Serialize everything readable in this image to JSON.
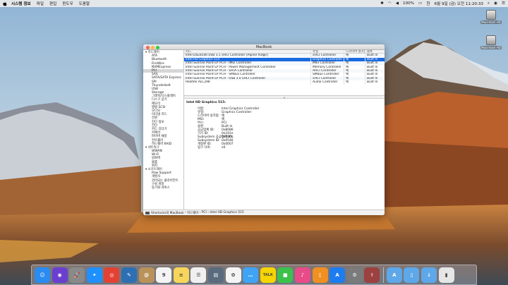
{
  "menubar": {
    "app_name": "시스템 정보",
    "menus": [
      "파일",
      "편집",
      "윈도우",
      "도움말"
    ],
    "battery": "100%",
    "datetime": "6월 9일 (금) 오전 11:20:33"
  },
  "desktop": {
    "disks": [
      "Macintosh HD",
      "Macintosh HD"
    ]
  },
  "window": {
    "title": "MacBook",
    "sidebar": [
      {
        "label": "▾ 하드웨어",
        "group": true
      },
      {
        "label": "ATA"
      },
      {
        "label": "Bluetooth"
      },
      {
        "label": "FireWire"
      },
      {
        "label": "NVMExpress"
      },
      {
        "label": "PCI",
        "selected": true
      },
      {
        "label": "SAS"
      },
      {
        "label": "SATA/SATA Express"
      },
      {
        "label": "SPI"
      },
      {
        "label": "Thunderbolt"
      },
      {
        "label": "USB"
      },
      {
        "label": "Storage"
      },
      {
        "label": "그래픽/디스플레이"
      },
      {
        "label": "디스크 굽기"
      },
      {
        "label": "메모리"
      },
      {
        "label": "병렬 SCSI"
      },
      {
        "label": "오디오"
      },
      {
        "label": "이더넷 카드"
      },
      {
        "label": "전원"
      },
      {
        "label": "진단 정보"
      },
      {
        "label": "전단"
      },
      {
        "label": "카드 리더기"
      },
      {
        "label": "카메라"
      },
      {
        "label": "파이버 채널"
      },
      {
        "label": "컨트롤러"
      },
      {
        "label": "하드웨어 RAID"
      },
      {
        "label": "▾ 네트워크",
        "group": true
      },
      {
        "label": "WWAN"
      },
      {
        "label": "Wi-Fi"
      },
      {
        "label": "방화벽"
      },
      {
        "label": "볼륨"
      },
      {
        "label": "위치"
      },
      {
        "label": "▾ 소프트웨어",
        "group": true
      },
      {
        "label": "Raw Support"
      },
      {
        "label": "개발자"
      },
      {
        "label": "관리되는 클라이언트"
      },
      {
        "label": "구성 파일"
      },
      {
        "label": "동기화 서비스"
      }
    ],
    "table": {
      "headers": [
        "카드",
        "유형",
        "드라이버 설치됨",
        "슬롯"
      ],
      "rows": [
        {
          "card": "Intel DSL6540 USB 3.1 xHCI Controller [Alpine Ridge]",
          "type": "xHCI Controller",
          "driver": "예",
          "slot": "Built In"
        },
        {
          "card": "Intel HD Graphics 515",
          "type": "Graphics Controller",
          "driver": "예",
          "slot": "Built In",
          "selected": true
        },
        {
          "card": "Intel Sunrise Point-LP PCH - IMEI Controller",
          "type": "IMEI Controller",
          "driver": "예",
          "slot": "Built In"
        },
        {
          "card": "Intel Sunrise Point-LP PCH - Power Management Controller",
          "type": "Memory Controller",
          "driver": "예",
          "slot": "Built In"
        },
        {
          "card": "Intel Sunrise Point-LP PCH - SATA Controller",
          "type": "AHCI Controller",
          "driver": "예",
          "slot": "Built In"
        },
        {
          "card": "Intel Sunrise Point-LP PCH - SMBus Controller",
          "type": "SMBus Controller",
          "driver": "예",
          "slot": "Built In"
        },
        {
          "card": "Intel Sunrise Point-LP PCH - USB 3.0 xHCI Controller",
          "type": "xHCI Controller",
          "driver": "예",
          "slot": "Built In"
        },
        {
          "card": "Realtek ALC298",
          "type": "Audio Controller",
          "driver": "예",
          "slot": "Built In"
        }
      ]
    },
    "detail": {
      "title": "Intel HD Graphics 515:",
      "rows": [
        {
          "key": "이름:",
          "value": "Intel Graphics Controller"
        },
        {
          "key": "유형:",
          "value": "Graphics Controller"
        },
        {
          "key": "드라이버 설치됨:",
          "value": "예"
        },
        {
          "key": "MSI:",
          "value": "예"
        },
        {
          "key": "버스:",
          "value": "PCI"
        },
        {
          "key": "슬롯:",
          "value": "Built In"
        },
        {
          "key": "공급업체 ID:",
          "value": "0x8086"
        },
        {
          "key": "기기 ID:",
          "value": "0x191e"
        },
        {
          "key": "Subsystem 공급업체 ID:",
          "value": "0x106b"
        },
        {
          "key": "Subsystem ID:",
          "value": "0x0546"
        },
        {
          "key": "개정판 ID:",
          "value": "0x0007"
        },
        {
          "key": "링크 너비:",
          "value": "x0"
        }
      ]
    },
    "pathbar": [
      "Sherlocks의 MacBook",
      "하드웨어",
      "PCI",
      "Intel HD Graphics 515"
    ]
  },
  "dock": {
    "items": [
      {
        "name": "finder-icon",
        "color": "#2a8cf0",
        "glyph": "☺"
      },
      {
        "name": "siri-icon",
        "color": "#6a3fd0",
        "glyph": "◉"
      },
      {
        "name": "launchpad-icon",
        "color": "#8a8a8a",
        "glyph": "🚀"
      },
      {
        "name": "safari-icon",
        "color": "#1e90ff",
        "glyph": "✦"
      },
      {
        "name": "chrome-icon",
        "color": "#e34133",
        "glyph": "◎"
      },
      {
        "name": "photo-app-icon",
        "color": "#2d6fb3",
        "glyph": "✎"
      },
      {
        "name": "contacts-icon",
        "color": "#b9925a",
        "glyph": "@"
      },
      {
        "name": "calendar-icon",
        "color": "#f4f4f4",
        "glyph": "9"
      },
      {
        "name": "notes-icon",
        "color": "#f7d55a",
        "glyph": "≡"
      },
      {
        "name": "reminders-icon",
        "color": "#f0f0f0",
        "glyph": "☰"
      },
      {
        "name": "keynote-icon",
        "color": "#5a6b7e",
        "glyph": "▤"
      },
      {
        "name": "photos-icon",
        "color": "#f4f4f4",
        "glyph": "✿"
      },
      {
        "name": "messages-icon",
        "color": "#3fa4f5",
        "glyph": "…"
      },
      {
        "name": "kakaotalk-icon",
        "color": "#f6d500",
        "glyph": "TALK"
      },
      {
        "name": "facetime-icon",
        "color": "#3cc24b",
        "glyph": "■"
      },
      {
        "name": "itunes-icon",
        "color": "#e84b8a",
        "glyph": "♪"
      },
      {
        "name": "ibooks-icon",
        "color": "#f08f22",
        "glyph": "▯"
      },
      {
        "name": "app-store-icon",
        "color": "#1d7cf0",
        "glyph": "A"
      },
      {
        "name": "system-preferences-icon",
        "color": "#7b7b7b",
        "glyph": "⚙"
      },
      {
        "name": "system-info-icon",
        "color": "#9c4040",
        "glyph": "⚕"
      }
    ],
    "folders": [
      {
        "name": "applications-folder-icon",
        "color": "#5ea7e8",
        "glyph": "A"
      },
      {
        "name": "documents-folder-icon",
        "color": "#5ea7e8",
        "glyph": "▯"
      },
      {
        "name": "downloads-folder-icon",
        "color": "#5ea7e8",
        "glyph": "↓"
      },
      {
        "name": "trash-icon",
        "color": "#e6e6e6",
        "glyph": "▮"
      }
    ]
  }
}
